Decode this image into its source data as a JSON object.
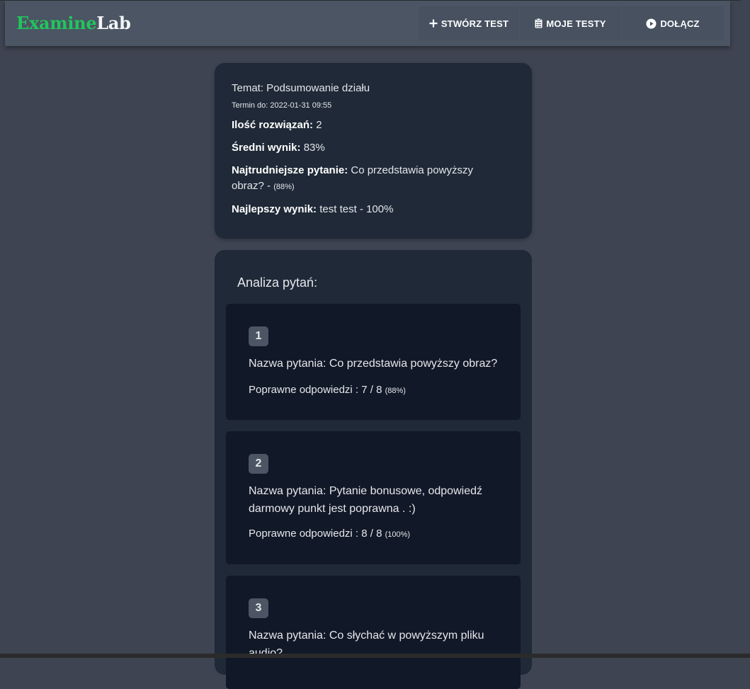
{
  "brand": {
    "part1": "Examine",
    "part2": "Lab"
  },
  "nav": {
    "create_test": "STWÓRZ TEST",
    "my_tests": "MOJE TESTY",
    "join": "DOŁĄCZ"
  },
  "summary": {
    "topic": "Temat: Podsumowanie działu",
    "deadline": "Termin do: 2022-01-31 09:55",
    "solutions_label": "Ilość rozwiązań:",
    "solutions_value": "2",
    "avg_label": "Średni wynik:",
    "avg_value": "83%",
    "hardest_label": "Najtrudniejsze pytanie:",
    "hardest_value": "Co przedstawia powyższy obraz? -",
    "hardest_pct": "(88%)",
    "best_label": "Najlepszy wynik:",
    "best_value": "test test - 100%"
  },
  "analysis": {
    "title": "Analiza pytań:",
    "questions": [
      {
        "num": "1",
        "name": "Nazwa pytania: Co przedstawia powyższy obraz?",
        "correct": "Poprawne odpowiedzi : 7 / 8",
        "pct": "(88%)"
      },
      {
        "num": "2",
        "name": "Nazwa pytania: Pytanie bonusowe, odpowiedź darmowy punkt jest poprawna . :)",
        "correct": "Poprawne odpowiedzi : 8 / 8",
        "pct": "(100%)"
      },
      {
        "num": "3",
        "name": "Nazwa pytania: Co słychać w powyższym pliku audio?",
        "correct": "",
        "pct": ""
      }
    ]
  },
  "colors": {
    "accent_green": "#22c55e",
    "page_bg": "#3e4451",
    "card_bg": "#1f2937",
    "item_bg": "#111827",
    "navbar_bg": "#4b5563"
  },
  "icons": {
    "create": "plus-icon",
    "my_tests": "clipboard-list-icon",
    "join": "play-circle-icon"
  }
}
